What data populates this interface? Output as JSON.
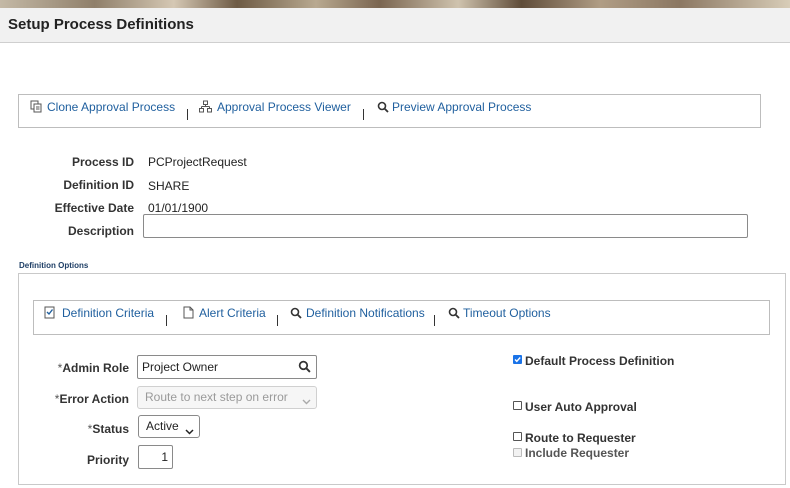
{
  "page": {
    "title": "Setup Process Definitions"
  },
  "top_links": [
    {
      "label": "Clone Approval Process",
      "icon": "clone-icon"
    },
    {
      "label": "Approval Process Viewer",
      "icon": "hierarchy-icon"
    },
    {
      "label": "Preview Approval Process",
      "icon": "magnifier-icon"
    }
  ],
  "fields": {
    "process_id": {
      "label": "Process ID",
      "value": "PCProjectRequest"
    },
    "definition_id": {
      "label": "Definition ID",
      "value": "SHARE"
    },
    "effective_date": {
      "label": "Effective Date",
      "value": "01/01/1900"
    },
    "description": {
      "label": "Description",
      "value": ""
    }
  },
  "definition_options": {
    "title": "Definition Options",
    "links": [
      {
        "label": "Definition Criteria",
        "icon": "criteria-icon"
      },
      {
        "label": "Alert Criteria",
        "icon": "document-icon"
      },
      {
        "label": "Definition Notifications",
        "icon": "magnifier-icon"
      },
      {
        "label": "Timeout Options",
        "icon": "magnifier-icon"
      }
    ],
    "admin_role": {
      "label": "Admin Role",
      "required": "*",
      "value": "Project Owner"
    },
    "error_action": {
      "label": "Error Action",
      "required": "*",
      "value": "Route to next step on error"
    },
    "status": {
      "label": "Status",
      "required": "*",
      "value": "Active"
    },
    "priority": {
      "label": "Priority",
      "value": "1"
    },
    "checkboxes": {
      "default_process": {
        "label": "Default Process Definition",
        "checked": true
      },
      "user_auto_approval": {
        "label": "User Auto Approval",
        "checked": false
      },
      "route_to_requester": {
        "label": "Route to Requester",
        "checked": false
      },
      "include_requester": {
        "label": "Include Requester",
        "checked": false,
        "disabled": true
      }
    }
  },
  "colors": {
    "link": "#1f5f9e",
    "checkbox_checked": "#1a73e8"
  }
}
